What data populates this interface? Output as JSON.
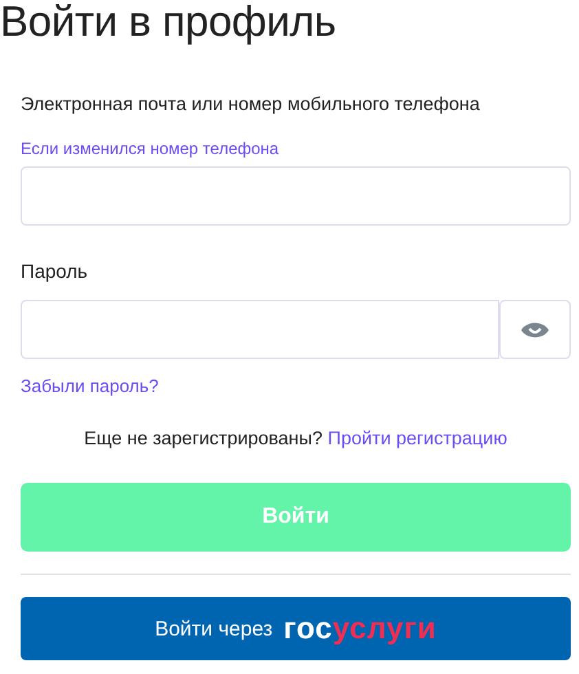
{
  "title": "Войти в профиль",
  "login_field": {
    "label": "Электронная почта или номер мобильного телефона",
    "hint_link": "Если изменился номер телефона"
  },
  "password_field": {
    "label": "Пароль"
  },
  "forgot_link": "Забыли пароль?",
  "register": {
    "text": "Еще не зарегистрированы?",
    "link": "Пройти регистрацию"
  },
  "login_button": {
    "label": "Войти",
    "disabled": true
  },
  "gosuslugi_button": {
    "label": "Войти через",
    "logo_first": "гос",
    "logo_second": "услуги"
  }
}
